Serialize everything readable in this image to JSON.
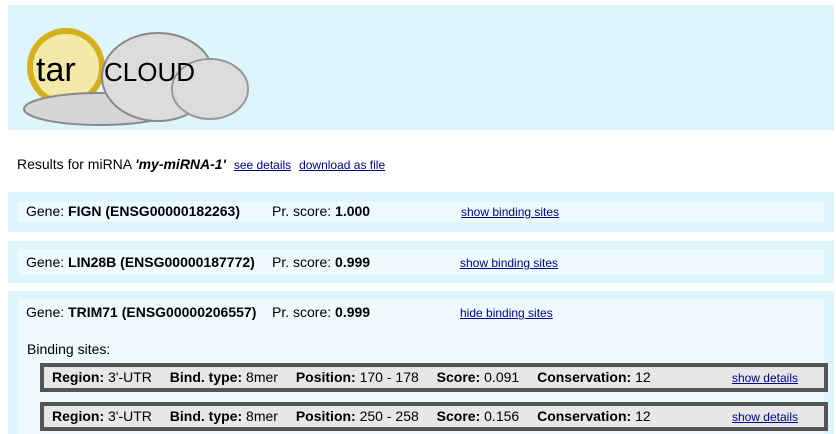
{
  "logo": {
    "text_tar": "tar",
    "text_cloud": "CLOUD"
  },
  "results": {
    "prefix": "Results for miRNA",
    "mirna": "'my-miRNA-1'",
    "see_details": "see details",
    "download": "download as file"
  },
  "genes": [
    {
      "gene_label": "Gene:",
      "gene": "FIGN (ENSG00000182263)",
      "score_label": "Pr. score:",
      "score": "1.000",
      "toggle": "show binding sites"
    },
    {
      "gene_label": "Gene:",
      "gene": "LIN28B (ENSG00000187772)",
      "score_label": "Pr. score:",
      "score": "0.999",
      "toggle": "show binding sites"
    },
    {
      "gene_label": "Gene:",
      "gene": "TRIM71 (ENSG00000206557)",
      "score_label": "Pr. score:",
      "score": "0.999",
      "toggle": "hide binding sites"
    }
  ],
  "binding_sites_label": "Binding sites:",
  "sites": [
    {
      "region_label": "Region:",
      "region": "3'-UTR",
      "type_label": "Bind. type:",
      "type": "8mer",
      "pos_label": "Position:",
      "pos": "170 - 178",
      "score_label": "Score:",
      "score": "0.091",
      "cons_label": "Conservation:",
      "cons": "12",
      "details": "show details"
    },
    {
      "region_label": "Region:",
      "region": "3'-UTR",
      "type_label": "Bind. type:",
      "type": "8mer",
      "pos_label": "Position:",
      "pos": "250 - 258",
      "score_label": "Score:",
      "score": "0.156",
      "cons_label": "Conservation:",
      "cons": "12",
      "details": "show details"
    }
  ]
}
